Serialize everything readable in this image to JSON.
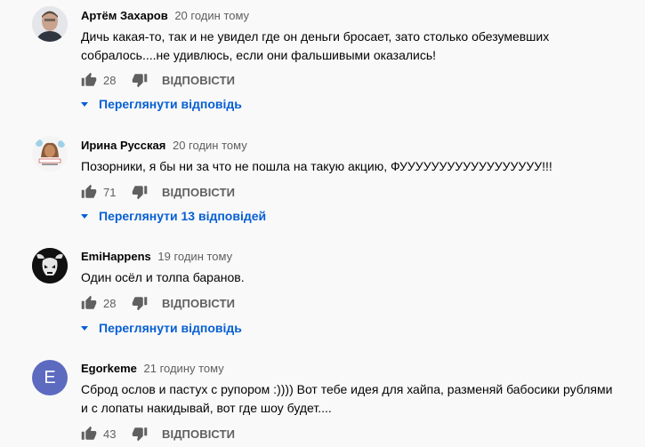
{
  "comments": [
    {
      "author": "Артём Захаров",
      "time": "20 годин тому",
      "lines": [
        "Дичь какая-то, так и не увидел где он деньги бросает, зато столько обезумевших",
        "собралось....не удивлюсь, если они фальшивыми оказались!"
      ],
      "likes": "28",
      "reply_label": "ВІДПОВІСТИ",
      "replies_label": "Переглянути відповідь"
    },
    {
      "author": "Ирина Русская",
      "time": "20 годин тому",
      "lines": [
        "Позорники, я бы ни за что не пошла на такую акцию, ФУУУУУУУУУУУУУУУУУУ!!!"
      ],
      "likes": "71",
      "reply_label": "ВІДПОВІСТИ",
      "replies_label": "Переглянути 13 відповідей"
    },
    {
      "author": "EmiHappens",
      "time": "19 годин тому",
      "lines": [
        "Один осёл и толпа баранов."
      ],
      "likes": "28",
      "reply_label": "ВІДПОВІСТИ",
      "replies_label": "Переглянути відповідь"
    },
    {
      "author": "Egorkeme",
      "time": "21 годину тому",
      "avatar_letter": "E",
      "lines": [
        "Сброд ослов и пастух с рупором :)))) Вот тебе идея для хайпа, разменяй бабосики рублями",
        "и с лопаты накидывай, вот где шоу будет...."
      ],
      "likes": "43",
      "reply_label": "ВІДПОВІСТИ"
    }
  ],
  "colors": {
    "background": "#f9f9f9",
    "link": "#065fd4",
    "meta": "#606060",
    "avatar_e": "#5c6bc0"
  }
}
